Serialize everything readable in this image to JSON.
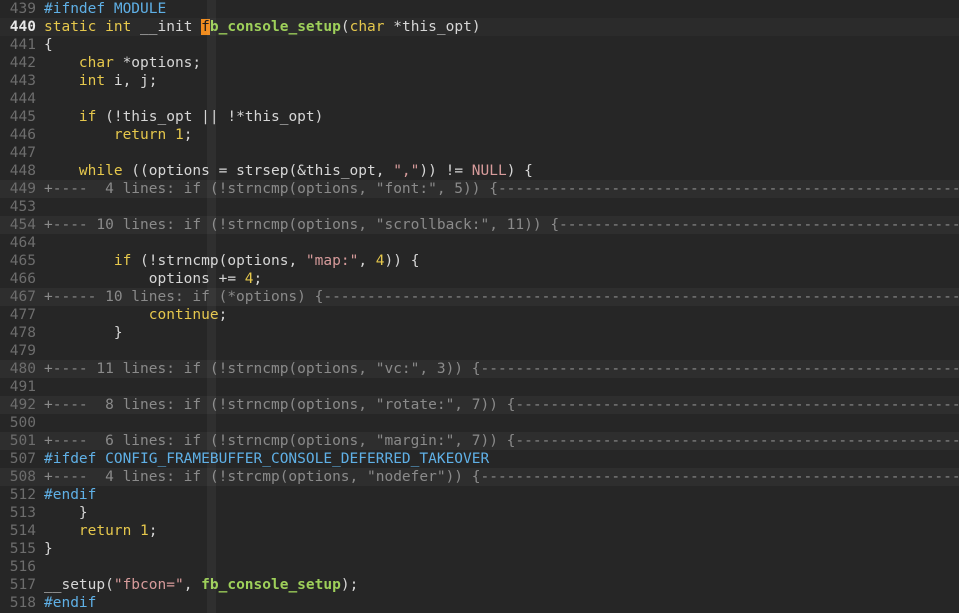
{
  "lines": [
    {
      "n": "439",
      "segs": [
        {
          "c": "pre",
          "t": "#ifndef MODULE"
        }
      ]
    },
    {
      "n": "440",
      "cur": true,
      "segs": [
        {
          "c": "type",
          "t": "static"
        },
        {
          "t": " "
        },
        {
          "c": "type",
          "t": "int"
        },
        {
          "t": " __init "
        },
        {
          "c": "cursor",
          "t": "f"
        },
        {
          "c": "fn",
          "t": "b_console_setup"
        },
        {
          "t": "("
        },
        {
          "c": "type",
          "t": "char"
        },
        {
          "t": " *this_opt)"
        }
      ]
    },
    {
      "n": "441",
      "segs": [
        {
          "t": "{"
        }
      ]
    },
    {
      "n": "442",
      "segs": [
        {
          "t": "    "
        },
        {
          "c": "type",
          "t": "char"
        },
        {
          "t": " *options;"
        }
      ]
    },
    {
      "n": "443",
      "segs": [
        {
          "t": "    "
        },
        {
          "c": "type",
          "t": "int"
        },
        {
          "t": " i, j;"
        }
      ]
    },
    {
      "n": "444",
      "segs": []
    },
    {
      "n": "445",
      "segs": [
        {
          "t": "    "
        },
        {
          "c": "kw",
          "t": "if"
        },
        {
          "t": " (!this_opt || !*this_opt)"
        }
      ]
    },
    {
      "n": "446",
      "segs": [
        {
          "t": "        "
        },
        {
          "c": "kw",
          "t": "return"
        },
        {
          "t": " "
        },
        {
          "c": "num",
          "t": "1"
        },
        {
          "t": ";"
        }
      ]
    },
    {
      "n": "447",
      "segs": []
    },
    {
      "n": "448",
      "segs": [
        {
          "t": "    "
        },
        {
          "c": "kw",
          "t": "while"
        },
        {
          "t": " ((options = strsep(&this_opt, "
        },
        {
          "c": "str",
          "t": "\",\""
        },
        {
          "t": ")) != "
        },
        {
          "c": "nul",
          "t": "NULL"
        },
        {
          "t": ") {"
        }
      ]
    },
    {
      "n": "449",
      "fold": true,
      "segs": [
        {
          "t": "+----  4 lines: if (!strncmp(options, \"font:\", 5)) {-------------------------------------------------------------------"
        }
      ]
    },
    {
      "n": "453",
      "segs": []
    },
    {
      "n": "454",
      "fold": true,
      "segs": [
        {
          "t": "+---- 10 lines: if (!strncmp(options, \"scrollback:\", 11)) {------------------------------------------------------------"
        }
      ]
    },
    {
      "n": "464",
      "segs": []
    },
    {
      "n": "465",
      "segs": [
        {
          "t": "        "
        },
        {
          "c": "kw",
          "t": "if"
        },
        {
          "t": " (!strncmp(options, "
        },
        {
          "c": "str",
          "t": "\"map:\""
        },
        {
          "t": ", "
        },
        {
          "c": "num",
          "t": "4"
        },
        {
          "t": ")) {"
        }
      ]
    },
    {
      "n": "466",
      "segs": [
        {
          "t": "            options += "
        },
        {
          "c": "num",
          "t": "4"
        },
        {
          "t": ";"
        }
      ]
    },
    {
      "n": "467",
      "fold": true,
      "segs": [
        {
          "t": "+----- 10 lines: if (*options) {-----------------------------------------------------------------------------------------"
        }
      ]
    },
    {
      "n": "477",
      "segs": [
        {
          "t": "            "
        },
        {
          "c": "kw",
          "t": "continue"
        },
        {
          "t": ";"
        }
      ]
    },
    {
      "n": "478",
      "segs": [
        {
          "t": "        }"
        }
      ]
    },
    {
      "n": "479",
      "segs": []
    },
    {
      "n": "480",
      "fold": true,
      "segs": [
        {
          "t": "+---- 11 lines: if (!strncmp(options, \"vc:\", 3)) {----------------------------------------------------------------------"
        }
      ]
    },
    {
      "n": "491",
      "segs": []
    },
    {
      "n": "492",
      "fold": true,
      "segs": [
        {
          "t": "+----  8 lines: if (!strncmp(options, \"rotate:\", 7)) {------------------------------------------------------------------"
        }
      ]
    },
    {
      "n": "500",
      "segs": []
    },
    {
      "n": "501",
      "fold": true,
      "segs": [
        {
          "t": "+----  6 lines: if (!strncmp(options, \"margin:\", 7)) {------------------------------------------------------------------"
        }
      ]
    },
    {
      "n": "507",
      "segs": [
        {
          "c": "pre",
          "t": "#ifdef CONFIG_FRAMEBUFFER_CONSOLE_DEFERRED_TAKEOVER"
        }
      ]
    },
    {
      "n": "508",
      "fold": true,
      "segs": [
        {
          "t": "+----  4 lines: if (!strcmp(options, \"nodefer\")) {----------------------------------------------------------------------"
        }
      ]
    },
    {
      "n": "512",
      "segs": [
        {
          "c": "pre",
          "t": "#endif"
        }
      ]
    },
    {
      "n": "513",
      "segs": [
        {
          "t": "    }"
        }
      ]
    },
    {
      "n": "514",
      "segs": [
        {
          "t": "    "
        },
        {
          "c": "kw",
          "t": "return"
        },
        {
          "t": " "
        },
        {
          "c": "num",
          "t": "1"
        },
        {
          "t": ";"
        }
      ]
    },
    {
      "n": "515",
      "segs": [
        {
          "t": "}"
        }
      ]
    },
    {
      "n": "516",
      "segs": []
    },
    {
      "n": "517",
      "segs": [
        {
          "t": "__setup("
        },
        {
          "c": "str",
          "t": "\"fbcon=\""
        },
        {
          "t": ", "
        },
        {
          "c": "fn",
          "t": "fb_console_setup"
        },
        {
          "t": ");"
        }
      ]
    },
    {
      "n": "518",
      "segs": [
        {
          "c": "pre",
          "t": "#endif"
        }
      ]
    }
  ]
}
